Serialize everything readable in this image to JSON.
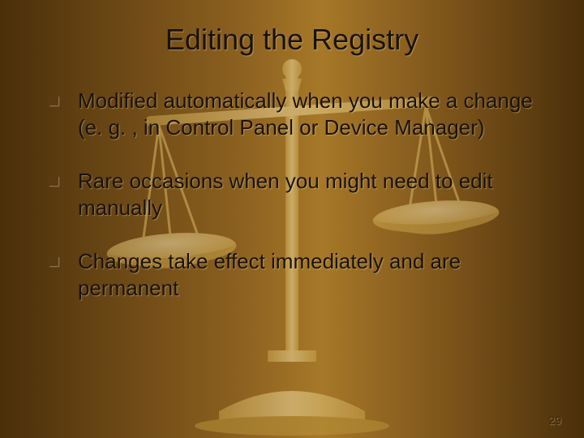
{
  "slide": {
    "title": "Editing the Registry",
    "bullets": [
      "Modified automatically when you make a change (e. g. , in Control Panel or Device Manager)",
      "Rare occasions when you might need to edit manually",
      "Changes take effect immediately and are permanent"
    ],
    "number": "29"
  }
}
